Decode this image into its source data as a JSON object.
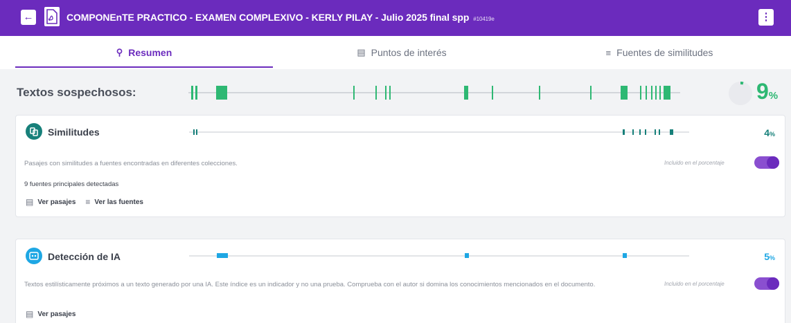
{
  "header": {
    "back_icon": "arrow-left-icon",
    "doc_icon": "pdf-file-icon",
    "title": "COMPONEnTE PRACTICO - EXAMEN COMPLEXIVO - KERLY PILAY - Julio 2025 final spp",
    "doc_id": "#10419e",
    "menu_icon": "kebab-menu-icon",
    "color": "#6b2bbd"
  },
  "tabs": [
    {
      "label": "Resumen",
      "icon": "magnifier-icon",
      "active": true
    },
    {
      "label": "Puntos de interés",
      "icon": "document-icon",
      "active": false
    },
    {
      "label": "Fuentes de similitudes",
      "icon": "list-icon",
      "active": false
    }
  ],
  "suspicious": {
    "label": "Textos sospechosos:",
    "percent": "9",
    "unit": "%",
    "color": "#2eb873"
  },
  "similarities": {
    "title": "Similitudes",
    "icon": "similarity-icon",
    "percent": "4",
    "unit": "%",
    "color": "#17807a",
    "description": "Pasajes con similitudes a fuentes encontradas en diferentes colecciones.",
    "included_label": "Incluido en el porcentaje",
    "included": true,
    "sources_note": "9 fuentes principales detectadas",
    "view_passages": "Ver pasajes",
    "view_sources": "Ver las fuentes"
  },
  "ai_detection": {
    "title": "Detección de IA",
    "icon": "ai-detection-icon",
    "percent": "5",
    "unit": "%",
    "color": "#1ea7e4",
    "description": "Textos estilísticamente próximos a un texto generado por una IA. Este índice es un indicador y no una prueba. Comprueba con el autor si domina los conocimientos mencionados en el documento.",
    "included_label": "Incluido en el porcentaje",
    "included": true,
    "view_passages": "Ver pasajes"
  }
}
